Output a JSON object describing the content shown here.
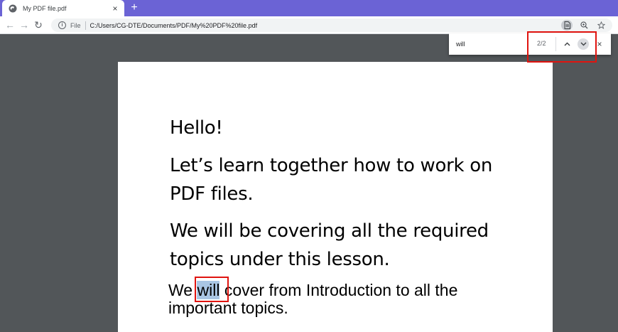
{
  "tab": {
    "title": "My PDF file.pdf",
    "close": "×"
  },
  "newtab": "+",
  "toolbar": {
    "back": "←",
    "forward": "→",
    "reload": "↻"
  },
  "omnibox": {
    "scheme": "File",
    "url": "C:/Users/CG-DTE/Documents/PDF/My%20PDF%20file.pdf"
  },
  "find": {
    "query": "will",
    "count": "2/2",
    "prev": "⌃",
    "next": "⌄",
    "close": "×"
  },
  "document": {
    "line1": "Hello!",
    "line2": "Let’s learn together how to work on PDF files.",
    "line3": "We will be covering all the required topics under this lesson.",
    "line4_before": "We ",
    "line4_match": "will",
    "line4_after": " cover from Introduction to all the important topics."
  },
  "colors": {
    "tabstrip": "#6b63d5",
    "viewer_bg": "#525659",
    "highlight": "#a9c6e4",
    "annotation": "#e0140f"
  }
}
